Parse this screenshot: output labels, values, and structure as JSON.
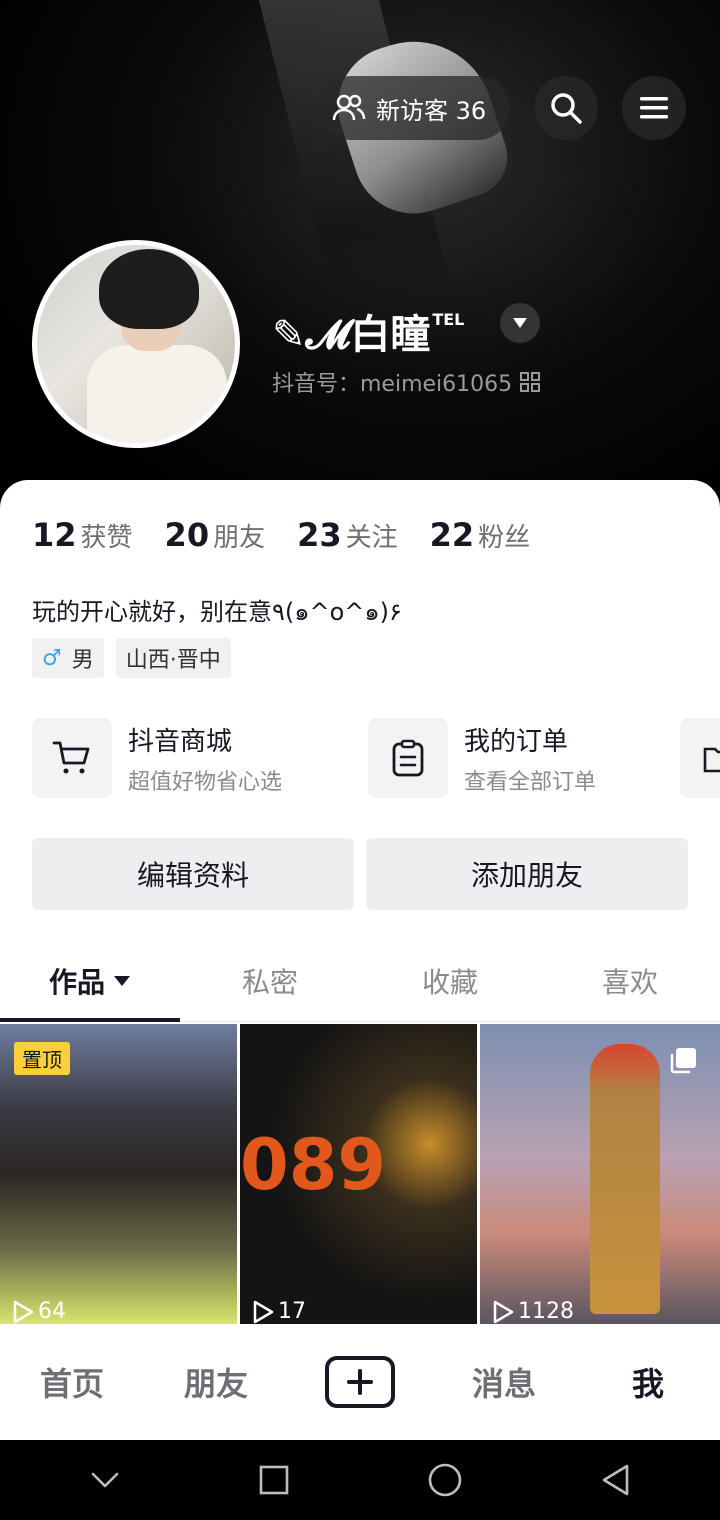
{
  "header": {
    "visitor_label": "新访客 36"
  },
  "profile": {
    "nickname": "✎𝓜白瞳",
    "nickname_suffix": "TEL",
    "douyin_id": "抖音号：meimei61065"
  },
  "stats": [
    {
      "num": "12",
      "label": "获赞"
    },
    {
      "num": "20",
      "label": "朋友"
    },
    {
      "num": "23",
      "label": "关注"
    },
    {
      "num": "22",
      "label": "粉丝"
    }
  ],
  "bio": "玩的开心就好，别在意٩(๑^o^๑)۶",
  "tags": {
    "gender": "男",
    "location": "山西·晋中"
  },
  "shop": [
    {
      "title": "抖音商城",
      "subtitle": "超值好物省心选"
    },
    {
      "title": "我的订单",
      "subtitle": "查看全部订单"
    }
  ],
  "actions": {
    "edit": "编辑资料",
    "add_friend": "添加朋友"
  },
  "tabs": [
    "作品",
    "私密",
    "收藏",
    "喜欢"
  ],
  "videos": [
    {
      "badge": "置顶",
      "plays": "64"
    },
    {
      "plays": "17",
      "overlay_text": "089"
    },
    {
      "plays": "1128"
    }
  ],
  "bottom_nav": [
    "首页",
    "朋友",
    "消息",
    "我"
  ]
}
